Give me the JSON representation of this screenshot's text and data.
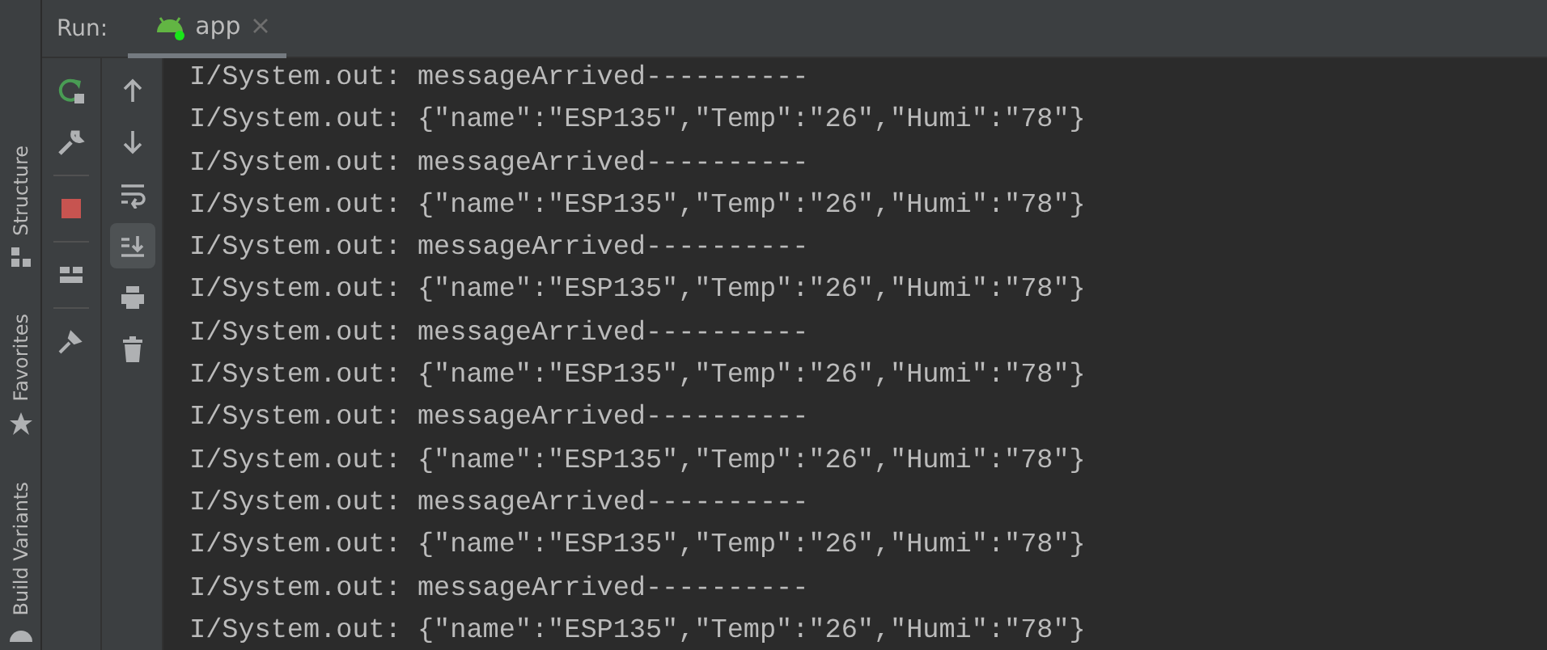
{
  "side_tabs": [
    {
      "label": "Structure",
      "kind": "structure"
    },
    {
      "label": "Favorites",
      "kind": "favorites"
    },
    {
      "label": "Build Variants",
      "kind": "build"
    }
  ],
  "tool_window": {
    "title": "Run:",
    "tabs": [
      {
        "label": "app",
        "selected": true
      }
    ]
  },
  "main_toolbar": [
    {
      "kind": "rerun"
    },
    {
      "kind": "wrench"
    },
    {
      "kind": "stop"
    },
    {
      "kind": "layout"
    },
    {
      "kind": "pin"
    }
  ],
  "console_toolbar": [
    {
      "kind": "up",
      "on": false
    },
    {
      "kind": "down",
      "on": false
    },
    {
      "kind": "wrap",
      "on": false
    },
    {
      "kind": "scroll-end",
      "on": true
    },
    {
      "kind": "print",
      "on": false
    },
    {
      "kind": "trash",
      "on": false
    }
  ],
  "console_lines": [
    "I/System.out: messageArrived----------",
    "I/System.out: {\"name\":\"ESP135\",\"Temp\":\"26\",\"Humi\":\"78\"}",
    "I/System.out: messageArrived----------",
    "I/System.out: {\"name\":\"ESP135\",\"Temp\":\"26\",\"Humi\":\"78\"}",
    "I/System.out: messageArrived----------",
    "I/System.out: {\"name\":\"ESP135\",\"Temp\":\"26\",\"Humi\":\"78\"}",
    "I/System.out: messageArrived----------",
    "I/System.out: {\"name\":\"ESP135\",\"Temp\":\"26\",\"Humi\":\"78\"}",
    "I/System.out: messageArrived----------",
    "I/System.out: {\"name\":\"ESP135\",\"Temp\":\"26\",\"Humi\":\"78\"}",
    "I/System.out: messageArrived----------",
    "I/System.out: {\"name\":\"ESP135\",\"Temp\":\"26\",\"Humi\":\"78\"}",
    "I/System.out: messageArrived----------",
    "I/System.out: {\"name\":\"ESP135\",\"Temp\":\"26\",\"Humi\":\"78\"}"
  ]
}
